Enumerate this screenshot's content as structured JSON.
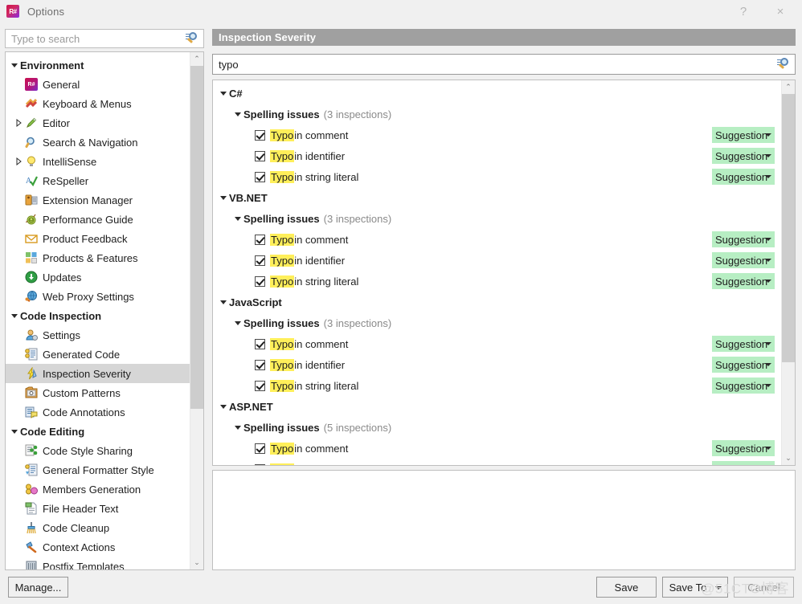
{
  "window": {
    "title": "Options",
    "app_icon": "resharper-icon",
    "help_button": "?",
    "close_button": "×"
  },
  "sidebar": {
    "search": {
      "placeholder": "Type to search",
      "value": ""
    },
    "groups": [
      {
        "label": "Environment",
        "expanded": true,
        "items": [
          {
            "label": "General",
            "icon": "resharper-icon",
            "expandable": false
          },
          {
            "label": "Keyboard & Menus",
            "icon": "keyboard-icon",
            "expandable": false
          },
          {
            "label": "Editor",
            "icon": "pencil-icon",
            "expandable": true
          },
          {
            "label": "Search & Navigation",
            "icon": "magnifier-icon",
            "expandable": false
          },
          {
            "label": "IntelliSense",
            "icon": "lightbulb-icon",
            "expandable": true
          },
          {
            "label": "ReSpeller",
            "icon": "spellcheck-icon",
            "expandable": false
          },
          {
            "label": "Extension Manager",
            "icon": "extension-icon",
            "expandable": false
          },
          {
            "label": "Performance Guide",
            "icon": "snail-icon",
            "expandable": false
          },
          {
            "label": "Product Feedback",
            "icon": "envelope-icon",
            "expandable": false
          },
          {
            "label": "Products & Features",
            "icon": "grid-squares-icon",
            "expandable": false
          },
          {
            "label": "Updates",
            "icon": "download-circle-icon",
            "expandable": false
          },
          {
            "label": "Web Proxy Settings",
            "icon": "globe-plug-icon",
            "expandable": false
          }
        ]
      },
      {
        "label": "Code Inspection",
        "expanded": true,
        "items": [
          {
            "label": "Settings",
            "icon": "person-gear-icon",
            "expandable": false
          },
          {
            "label": "Generated Code",
            "icon": "generated-code-icon",
            "expandable": false
          },
          {
            "label": "Inspection Severity",
            "icon": "severity-icon",
            "expandable": false,
            "selected": true
          },
          {
            "label": "Custom Patterns",
            "icon": "custom-patterns-icon",
            "expandable": false
          },
          {
            "label": "Code Annotations",
            "icon": "annotations-icon",
            "expandable": false
          }
        ]
      },
      {
        "label": "Code Editing",
        "expanded": true,
        "items": [
          {
            "label": "Code Style Sharing",
            "icon": "share-icon",
            "expandable": false
          },
          {
            "label": "General Formatter Style",
            "icon": "formatter-icon",
            "expandable": false
          },
          {
            "label": "Members Generation",
            "icon": "members-icon",
            "expandable": false
          },
          {
            "label": "File Header Text",
            "icon": "file-header-icon",
            "expandable": false
          },
          {
            "label": "Code Cleanup",
            "icon": "broom-icon",
            "expandable": false
          },
          {
            "label": "Context Actions",
            "icon": "hammer-icon",
            "expandable": false
          },
          {
            "label": "Postfix Templates",
            "icon": "postfix-icon",
            "expandable": false
          }
        ]
      }
    ],
    "scrollbar": {
      "up": "⌃",
      "down": "⌄",
      "thumb_top_pct": 0,
      "thumb_height_pct": 70
    }
  },
  "main": {
    "header_title": "Inspection Severity",
    "filter": {
      "value": "typo",
      "placeholder": ""
    },
    "tree": [
      {
        "language": "C#",
        "category": "Spelling issues",
        "count": "(3 inspections)",
        "inspections": [
          {
            "highlight": "Typo",
            "rest": " in comment",
            "checked": true,
            "severity": "Suggestion"
          },
          {
            "highlight": "Typo",
            "rest": " in identifier",
            "checked": true,
            "severity": "Suggestion"
          },
          {
            "highlight": "Typo",
            "rest": " in string literal",
            "checked": true,
            "severity": "Suggestion"
          }
        ]
      },
      {
        "language": "VB.NET",
        "category": "Spelling issues",
        "count": "(3 inspections)",
        "inspections": [
          {
            "highlight": "Typo",
            "rest": " in comment",
            "checked": true,
            "severity": "Suggestion"
          },
          {
            "highlight": "Typo",
            "rest": " in identifier",
            "checked": true,
            "severity": "Suggestion"
          },
          {
            "highlight": "Typo",
            "rest": " in string literal",
            "checked": true,
            "severity": "Suggestion"
          }
        ]
      },
      {
        "language": "JavaScript",
        "category": "Spelling issues",
        "count": "(3 inspections)",
        "inspections": [
          {
            "highlight": "Typo",
            "rest": " in comment",
            "checked": true,
            "severity": "Suggestion"
          },
          {
            "highlight": "Typo",
            "rest": " in identifier",
            "checked": true,
            "severity": "Suggestion"
          },
          {
            "highlight": "Typo",
            "rest": " in string literal",
            "checked": true,
            "severity": "Suggestion"
          }
        ]
      },
      {
        "language": "ASP.NET",
        "category": "Spelling issues",
        "count": "(5 inspections)",
        "inspections": [
          {
            "highlight": "Typo",
            "rest": " in comment",
            "checked": true,
            "severity": "Suggestion"
          },
          {
            "highlight": "Typo",
            "rest": " in identifier",
            "checked": true,
            "severity": "Suggestion"
          }
        ]
      }
    ],
    "scrollbar": {
      "up": "⌃",
      "down": "⌄",
      "thumb_top_pct": 0,
      "thumb_height_pct": 75
    }
  },
  "footer": {
    "manage_label": "Manage...",
    "save_label": "Save",
    "save_to_label": "Save To",
    "cancel_label": "Cancel"
  },
  "watermark": "@51CTO博客",
  "colors": {
    "severity_green": "#b7eec3",
    "highlight_yellow": "#ffef5a",
    "header_gray": "#a0a0a0",
    "selection_gray": "#d6d6d6"
  }
}
